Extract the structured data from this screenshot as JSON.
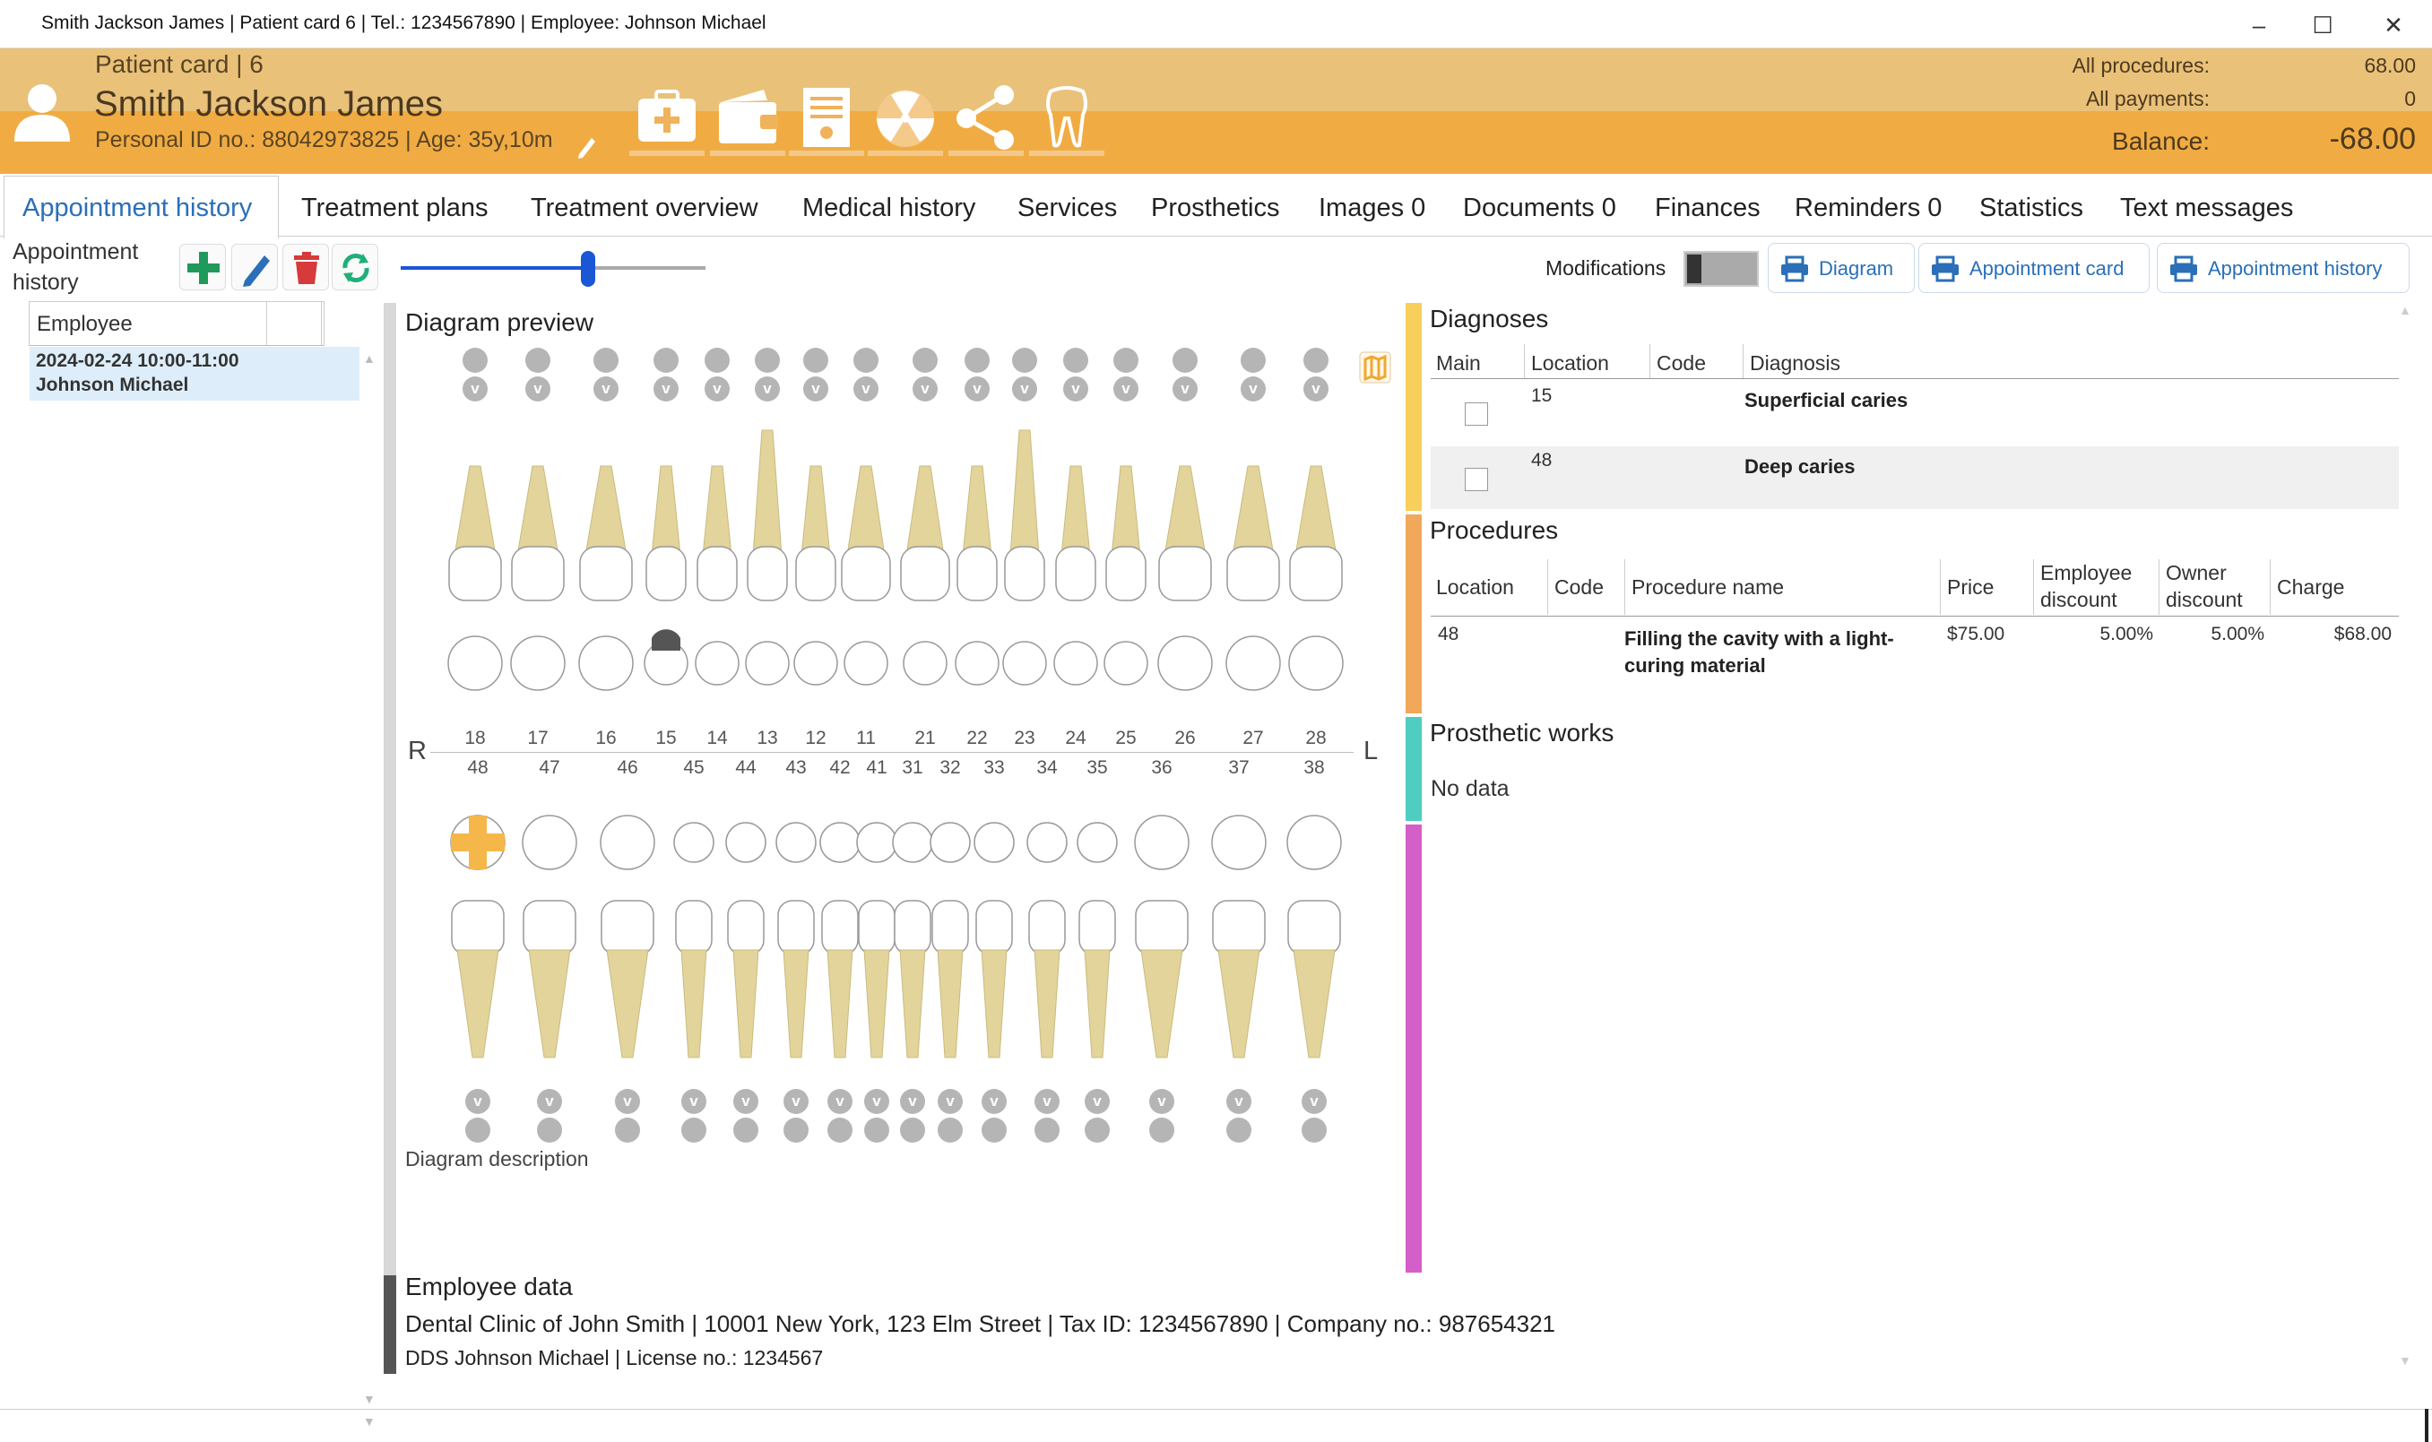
{
  "window": {
    "title": "Smith Jackson James | Patient card 6 | Tel.: 1234567890 | Employee: Johnson Michael"
  },
  "header": {
    "card_label": "Patient card | 6",
    "patient_name": "Smith Jackson James",
    "personal_line": "Personal ID no.: 88042973825 | Age: 35y,10m",
    "all_procedures_label": "All procedures:",
    "all_procedures_value": "68.00",
    "all_payments_label": "All payments:",
    "all_payments_value": "0",
    "balance_label": "Balance:",
    "balance_value": "-68.00",
    "colors": {
      "top": "#e9c179",
      "bottom": "#f0ac43"
    }
  },
  "tabs": [
    {
      "label": "Appointment history",
      "active": true
    },
    {
      "label": "Treatment plans"
    },
    {
      "label": "Treatment overview"
    },
    {
      "label": "Medical history"
    },
    {
      "label": "Services"
    },
    {
      "label": "Prosthetics"
    },
    {
      "label": "Images 0"
    },
    {
      "label": "Documents 0"
    },
    {
      "label": "Finances"
    },
    {
      "label": "Reminders 0"
    },
    {
      "label": "Statistics"
    },
    {
      "label": "Text messages"
    }
  ],
  "toolbar": {
    "history_label": "Appointment history",
    "modifications_label": "Modifications",
    "print_diagram": "Diagram",
    "print_appointment_card": "Appointment card",
    "print_appointment_history": "Appointment history",
    "slider_value_fraction": 0.57
  },
  "left_list": {
    "column_header": "Employee",
    "rows": [
      {
        "date": "2024-02-24 10:00-11:00",
        "employee": "Johnson Michael"
      }
    ]
  },
  "diagram": {
    "title": "Diagram preview",
    "right_label": "R",
    "left_label": "L",
    "upper_numbers": [
      "18",
      "17",
      "16",
      "15",
      "14",
      "13",
      "12",
      "11",
      "21",
      "22",
      "23",
      "24",
      "25",
      "26",
      "27",
      "28"
    ],
    "lower_numbers": [
      "48",
      "47",
      "46",
      "45",
      "44",
      "43",
      "42",
      "41",
      "31",
      "32",
      "33",
      "34",
      "35",
      "36",
      "37",
      "38"
    ],
    "v_label": "v",
    "description_label": "Diagram description"
  },
  "diagnoses": {
    "title": "Diagnoses",
    "headers": [
      "Main",
      "Location",
      "Code",
      "Diagnosis"
    ],
    "rows": [
      {
        "location": "15",
        "code": "",
        "diagnosis": "Superficial caries"
      },
      {
        "location": "48",
        "code": "",
        "diagnosis": "Deep caries"
      }
    ]
  },
  "procedures": {
    "title": "Procedures",
    "headers": {
      "location": "Location",
      "code": "Code",
      "name": "Procedure name",
      "price": "Price",
      "emp_disc_1": "Employee",
      "emp_disc_2": "discount",
      "own_disc_1": "Owner",
      "own_disc_2": "discount",
      "charge": "Charge"
    },
    "rows": [
      {
        "location": "48",
        "code": "",
        "name_1": "Filling the cavity with a light-",
        "name_2": "curing material",
        "price": "$75.00",
        "employee_discount": "5.00%",
        "owner_discount": "5.00%",
        "charge": "$68.00"
      }
    ]
  },
  "prosthetic": {
    "title": "Prosthetic works",
    "empty": "No data"
  },
  "employee_data": {
    "title": "Employee data",
    "clinic_line": "Dental Clinic of John Smith | 10001 New York, 123 Elm Street | Tax ID: 1234567890 | Company no.: 987654321",
    "doctor_line": "DDS Johnson Michael | License no.: 1234567"
  },
  "section_colors": {
    "diagnoses": "#f7cf5a",
    "procedures": "#f2a85a",
    "prosthetic": "#4fcdc0",
    "other": "#d55fc9"
  }
}
